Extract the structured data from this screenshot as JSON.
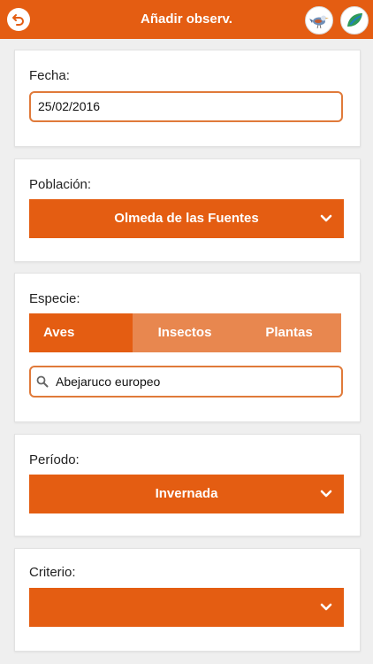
{
  "header": {
    "title": "Añadir observ.",
    "accent": "#e45d12",
    "back_icon": "undo-arrow-icon",
    "bird_icon": "bird-icon",
    "leaf_icon": "leaf-icon"
  },
  "fecha": {
    "label": "Fecha:",
    "value": "25/02/2016"
  },
  "poblacion": {
    "label": "Población:",
    "selected": "Olmeda de las Fuentes"
  },
  "especie": {
    "label": "Especie:",
    "tabs": [
      {
        "label": "Aves",
        "active": true
      },
      {
        "label": "Insectos",
        "active": false
      },
      {
        "label": "Plantas",
        "active": false
      }
    ],
    "search_value": "Abejaruco europeo"
  },
  "periodo": {
    "label": "Período:",
    "selected": "Invernada"
  },
  "criterio": {
    "label": "Criterio:",
    "selected": ""
  }
}
